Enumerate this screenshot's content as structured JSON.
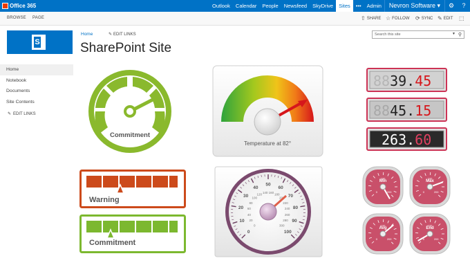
{
  "suite_bar": {
    "brand": "Office 365",
    "links": [
      "Outlook",
      "Calendar",
      "People",
      "Newsfeed",
      "SkyDrive",
      "Sites",
      "•••",
      "Admin"
    ],
    "active": "Sites",
    "user": "Nevron Software",
    "user_caret": "▾",
    "settings_icon": "⚙",
    "help_icon": "?"
  },
  "ribbon": {
    "tabs": [
      "BROWSE",
      "PAGE"
    ],
    "actions": [
      {
        "icon": "share-icon",
        "glyph": "⇧",
        "label": "SHARE"
      },
      {
        "icon": "star-icon",
        "glyph": "☆",
        "label": "FOLLOW"
      },
      {
        "icon": "sync-icon",
        "glyph": "⟳",
        "label": "SYNC"
      },
      {
        "icon": "pencil-icon",
        "glyph": "✎",
        "label": "EDIT"
      },
      {
        "icon": "focus-icon",
        "glyph": "⬚",
        "label": ""
      }
    ]
  },
  "header": {
    "breadcrumb": "Home",
    "edit_links": "EDIT LINKS",
    "title": "SharePoint Site",
    "search_placeholder": "Search this site"
  },
  "left_nav": {
    "items": [
      "Home",
      "Notebook",
      "Documents",
      "Site Contents"
    ],
    "selected": "Home",
    "edit_links": "EDIT LINKS"
  },
  "gauges": {
    "commitment_radial": {
      "label": "Commitment",
      "color": "#8ab92d"
    },
    "temperature": {
      "label": "Temperature at 82°",
      "value": 82
    },
    "warning_bar": {
      "label": "Warning",
      "color": "#cc4a1b",
      "segments": 6
    },
    "commitment_bar": {
      "label": "Commitment",
      "color": "#7cb82f",
      "segments": 6
    },
    "speedometer": {
      "outer_ticks": [
        "0",
        "10",
        "20",
        "30",
        "40",
        "50",
        "60",
        "70",
        "80",
        "90",
        "100"
      ],
      "inner_ticks": [
        "0",
        "20",
        "40",
        "60",
        "80",
        "100",
        "120",
        "140",
        "160",
        "180",
        "200",
        "220",
        "240",
        "260",
        "280",
        "300"
      ]
    },
    "led_displays": [
      {
        "dim": "88",
        "lit": "39.",
        "red": "45",
        "frame": "#cc3355"
      },
      {
        "dim": "88",
        "lit": "45.",
        "red": "15",
        "frame": "#cc3355"
      },
      {
        "dim": "",
        "lit": "263.",
        "red": "60",
        "frame": "#cc3355"
      }
    ],
    "small_gauges": [
      {
        "label": "Min",
        "ticks": [
          "0",
          "100",
          "200"
        ]
      },
      {
        "label": "Max",
        "ticks": [
          "0",
          "100",
          "200"
        ]
      },
      {
        "label": "Avg",
        "ticks": [
          "0",
          "100",
          "200"
        ]
      },
      {
        "label": "End",
        "ticks": [
          "0",
          "100",
          "200"
        ]
      }
    ]
  }
}
